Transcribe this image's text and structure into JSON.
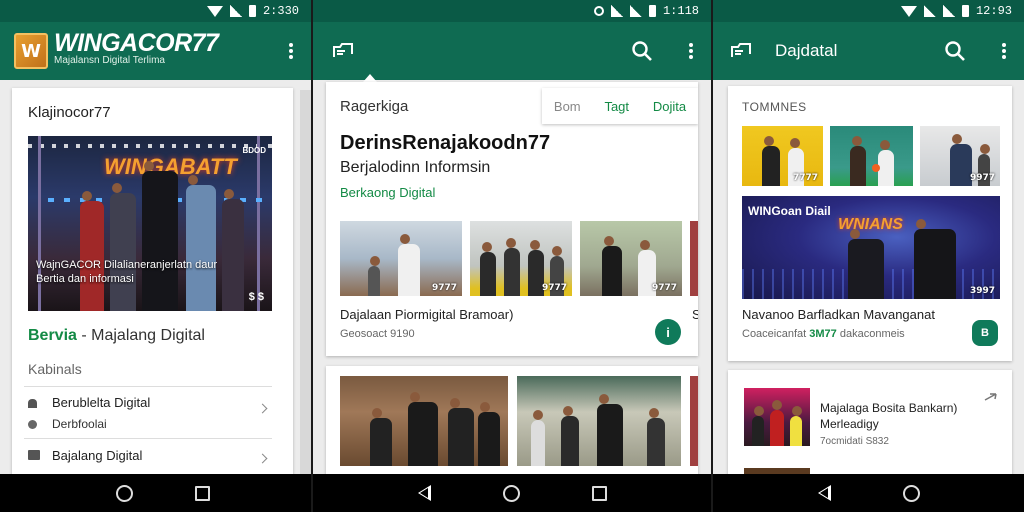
{
  "status": {
    "p1_time": "2:330",
    "p2_time": "1:118",
    "p3_time": "12:93"
  },
  "p1": {
    "logo_text": "WINGACOR77",
    "logo_subtitle": "Majalansn Digital Terlima",
    "card_title": "Klajinocor77",
    "hero_title": "WINGABATT",
    "hero_corner": "BDOD",
    "hero_caption": "WajnGACOR Dilalianeranjerlatn daur Bertia dan informasi",
    "hero_badge": "$ $",
    "brand_green": "Bervia",
    "brand_rest": " - Majalang Digital",
    "section_label": "Kabinals",
    "rows": [
      {
        "title": "Berublelta Digital",
        "sub": "Derbfoolai"
      },
      {
        "title": "Bajalang Digital",
        "sub": ""
      }
    ]
  },
  "p2": {
    "card_label": "Ragerkiga",
    "tabs": [
      "Bom",
      "Tagt",
      "Dojita"
    ],
    "headline": "DerinsRenajakoodn77",
    "subheadline": "Berjalodinn Informsin",
    "green_text": "Berkaong Digital",
    "thumb_badges": [
      "9777",
      "9777",
      "9777"
    ],
    "caption": "Dajalaan Piormigital Bramoar)",
    "meta": "Geosoact 9190",
    "caption_cut": "S",
    "fab_icon": "i"
  },
  "p3": {
    "appbar_title": "Dajdatal",
    "section": "TOMMNES",
    "thumb_badges": [
      "7777",
      "",
      "9977"
    ],
    "banner_text1": "WINGoan Diail",
    "banner_text2": "WNIANS",
    "banner_badge": "3997",
    "caption": "Navanoo Barfladkan Mavanganat",
    "meta_pre": "Coaceicanfat ",
    "meta_green": "3M77",
    "meta_post": " dakaconmeis",
    "fab_icon": "B",
    "list_title": "Majalaga Bosita Bankarn) Merleadigy",
    "list_meta": "7ocmidati S832"
  },
  "colors": {
    "appbar": "#0f6b52",
    "statusbar": "#0a5a46",
    "accent_green": "#138a45"
  }
}
